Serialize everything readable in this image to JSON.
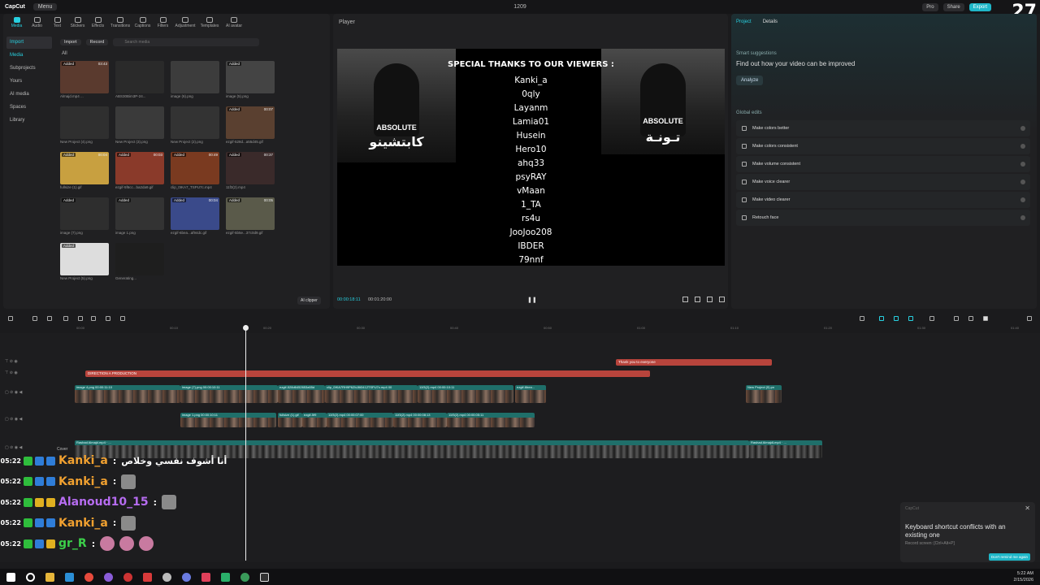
{
  "topbar": {
    "logo": "CapCut",
    "menu_label": "Menu",
    "title": "1209",
    "pro_label": "Pro",
    "share_label": "Share",
    "export_label": "Export",
    "corner_number": "27"
  },
  "media_panel": {
    "tool_tabs": [
      "Media",
      "Audio",
      "Text",
      "Stickers",
      "Effects",
      "Transitions",
      "Captions",
      "Filters",
      "Adjustment",
      "Templates",
      "AI avatar"
    ],
    "side_nav": [
      "Import",
      "Media",
      "Subprojects",
      "Yours",
      "AI media",
      "Spaces",
      "Library"
    ],
    "import_btn": "Import",
    "record_btn": "Record",
    "search_placeholder": "Search media",
    "all_label": "All",
    "ai_clipper": "AI clipper",
    "items": [
      {
        "tag": "Added",
        "dur": "03:43",
        "cap": "Almajd.mp4 ..."
      },
      {
        "tag": "",
        "dur": "",
        "cap": "ABS30Bim3P-24..."
      },
      {
        "tag": "",
        "dur": "",
        "cap": "image (6).png"
      },
      {
        "tag": "Added",
        "dur": "",
        "cap": "image (5).png"
      },
      {
        "tag": "",
        "dur": "",
        "cap": "New Project (4).png"
      },
      {
        "tag": "",
        "dur": "",
        "cap": "New Project (3).png"
      },
      {
        "tag": "",
        "dur": "",
        "cap": "New Project (2).png"
      },
      {
        "tag": "Added",
        "dur": "00:07",
        "cap": "ezgif-528d...a55d45.gif"
      },
      {
        "tag": "Added",
        "dur": "00:04",
        "cap": "fullsize (1).gif"
      },
      {
        "tag": "Added",
        "dur": "00:03",
        "cap": "ezgif-5f6cc...ba2da9.gif"
      },
      {
        "tag": "Added",
        "dur": "00:49",
        "cap": "clip_0IKA7_TSPU7c.mp4"
      },
      {
        "tag": "Added",
        "dur": "00:37",
        "cap": "11f3(2).mp4"
      },
      {
        "tag": "Added",
        "dur": "",
        "cap": "image (7).png"
      },
      {
        "tag": "Added",
        "dur": "",
        "cap": "image 1.png"
      },
      {
        "tag": "Added",
        "dur": "00:04",
        "cap": "ezgif-6bea...af94dc.gif"
      },
      {
        "tag": "Added",
        "dur": "00:05",
        "cap": "ezgif-5b5e...37c0d9.gif"
      },
      {
        "tag": "Added",
        "dur": "",
        "cap": "New Project (5).png"
      },
      {
        "tag": "",
        "dur": "",
        "cap": "Generating..."
      }
    ]
  },
  "player": {
    "title": "Player",
    "header_text": "SPECIAL THANKS TO OUR VIEWERS :",
    "viewers": [
      "Kanki_a",
      "0qly",
      "Layanm",
      "Lamia01",
      "Husein",
      "Hero10",
      "ahq33",
      "psyRAY",
      "vMaan",
      "1_TA",
      "rs4u",
      "JooJoo208",
      "IBDER",
      "79nnf"
    ],
    "poster_left_brand": "ABSOLUTE",
    "poster_left_arabic": "كابتشينو",
    "poster_right_brand": "ABSOLUTE",
    "poster_right_arabic": "تـونـة",
    "time_current": "00:00:18:11",
    "time_total": "00:01:20:00",
    "pause_icon": "❚❚"
  },
  "right_panel": {
    "tabs": [
      "Project",
      "Details"
    ],
    "smart_title": "Smart suggestions",
    "smart_desc": "Find out how your video can be improved",
    "analyze_label": "Analyze",
    "global_title": "Global edits",
    "edits": [
      "Make colors better",
      "Make colors consistent",
      "Make volume consistent",
      "Make voice clearer",
      "Make video clearer",
      "Retouch face"
    ]
  },
  "timeline": {
    "ticks": [
      "00:00",
      "00:10",
      "00:20",
      "00:30",
      "00:40",
      "00:50",
      "01:00",
      "01:10",
      "01:20",
      "01:30",
      "01:40"
    ],
    "red_clips": [
      "DIRECTION A PRODUCTION",
      "Thank you to everyone"
    ],
    "track1_labels": [
      "image 4.png 00:00:11:10",
      "image (7).png 00:00:10:11",
      "ezgif-528d6452653a55d",
      "clip_0IKA7RH9P6ZbJ8t3412TSPU7c.mp4 00",
      "11f3(2).mp4 00:00:10:11",
      "ezgif-6bea...",
      "New Project (5).pn"
    ],
    "track2_labels": [
      "image 1.png 00:00:10:11",
      "fullsize (1).gif",
      "ezgif-5f9",
      "11f3(2).mp4 00:00:07:00",
      "11f3(2).mp4 00:00:08:13",
      "11f3(2).mp4 00:00:05:11"
    ],
    "main_labels": [
      "Rashad Almajd.mp4 · ...",
      "Rashad AlmajdLmp4 · ..."
    ],
    "cover_label": "Cover"
  },
  "chat": [
    {
      "time": "05:22",
      "name": "Kanki_a",
      "name_color": "#f0a030",
      "msg": "أنا أشوف نفسي وخلاص",
      "emotes": 0
    },
    {
      "time": "05:22",
      "name": "Kanki_a",
      "name_color": "#f0a030",
      "msg": "",
      "emotes": 1
    },
    {
      "time": "05:22",
      "name": "Alanoud10_15",
      "name_color": "#b66cf0",
      "msg": "",
      "emotes": 1
    },
    {
      "time": "05:22",
      "name": "Kanki_a",
      "name_color": "#f0a030",
      "msg": "",
      "emotes": 1
    },
    {
      "time": "05:22",
      "name": "gr_R",
      "name_color": "#3cd04a",
      "msg": "",
      "emotes": 3
    }
  ],
  "toast": {
    "app": "CapCut",
    "message": "Keyboard shortcut conflicts with an existing one",
    "sub": "Record screen: [Ctrl+Alt+P]",
    "button": "Don't remind me again"
  },
  "taskbar": {
    "time": "5:22 AM",
    "date": "2/15/2026"
  },
  "colors": {
    "accent": "#28d0e0",
    "export": "#1fb7c8",
    "red_clip": "#b8443c"
  }
}
